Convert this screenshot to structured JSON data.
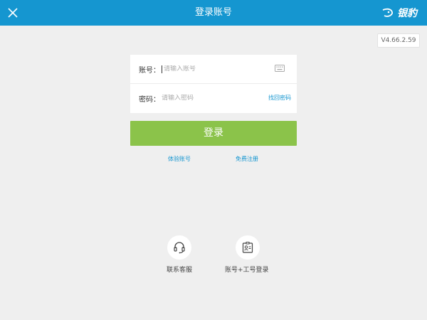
{
  "header": {
    "title": "登录账号",
    "logo_text": "银豹",
    "close_icon": "close-icon",
    "bg_color": "#1596d0"
  },
  "version": "V4.66.2.59",
  "form": {
    "account_label": "账号：",
    "account_placeholder": "请输入账号",
    "account_value": "",
    "password_label": "密码：",
    "password_placeholder": "请输入密码",
    "password_value": "",
    "keyboard_icon": "keyboard-icon",
    "find_password": "找回密码"
  },
  "login_button": {
    "label": "登录",
    "color": "#8bc34a"
  },
  "links": {
    "trial": "体验账号",
    "register": "免费注册"
  },
  "bottom_actions": [
    {
      "label": "联系客服",
      "icon": "headset-icon"
    },
    {
      "label": "账号+工号登录",
      "icon": "id-badge-icon"
    }
  ]
}
